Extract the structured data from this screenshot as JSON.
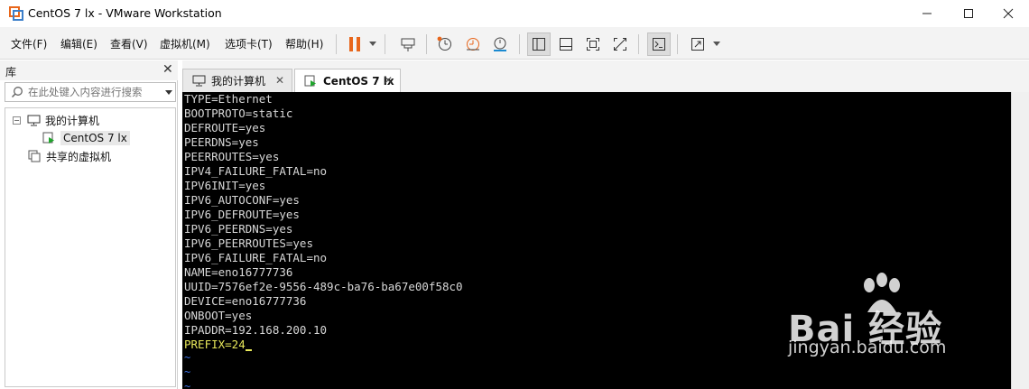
{
  "window": {
    "title": "CentOS 7 lx - VMware Workstation",
    "controls": [
      "minimize",
      "maximize",
      "close"
    ]
  },
  "menu": [
    "文件(F)",
    "编辑(E)",
    "查看(V)",
    "虚拟机(M)",
    "选项卡(T)",
    "帮助(H)"
  ],
  "toolbar": {
    "icons": [
      "pause-icon",
      "send-keys-icon",
      "snapshot-icon",
      "revert-snapshot-icon",
      "snapshot-manager-icon",
      "library-view-icon",
      "thumbnail-bar-icon",
      "full-screen-icon",
      "unity-icon",
      "console-view-icon",
      "stretch-icon"
    ],
    "accent_color": "#e8661b"
  },
  "library": {
    "title": "库",
    "search_placeholder": "在此处键入内容进行搜索",
    "tree": {
      "root": "我的计算机",
      "vm": "CentOS 7 lx",
      "shared": "共享的虚拟机"
    }
  },
  "tabs": [
    {
      "label": "我的计算机",
      "active": false
    },
    {
      "label": "CentOS 7 lx",
      "active": true
    }
  ],
  "console": {
    "lines": [
      "TYPE=Ethernet",
      "BOOTPROTO=static",
      "DEFROUTE=yes",
      "PEERDNS=yes",
      "PEERROUTES=yes",
      "IPV4_FAILURE_FATAL=no",
      "IPV6INIT=yes",
      "IPV6_AUTOCONF=yes",
      "IPV6_DEFROUTE=yes",
      "IPV6_PEERDNS=yes",
      "IPV6_PEERROUTES=yes",
      "IPV6_FAILURE_FATAL=no",
      "NAME=eno16777736",
      "UUID=7576ef2e-9556-489c-ba76-ba67e00f58c0",
      "DEVICE=eno16777736",
      "ONBOOT=yes",
      "IPADDR=192.168.200.10"
    ],
    "current_line": "PREFIX=24",
    "tilde": "~",
    "text_color": "#d8d8d8",
    "highlight_color": "#e8e85a",
    "tilde_color": "#3a6fe0"
  },
  "watermark": {
    "brand": "Bai 经验",
    "url": "jingyan.baidu.com"
  }
}
